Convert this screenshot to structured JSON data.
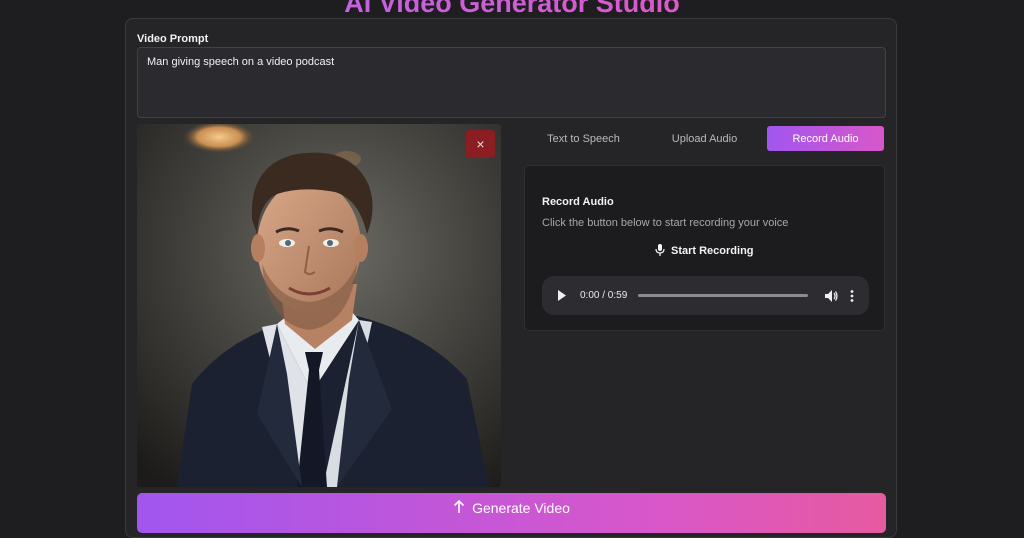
{
  "app": {
    "title": "AI Video Generator Studio"
  },
  "prompt": {
    "label": "Video Prompt",
    "value": "Man giving speech on a video podcast"
  },
  "image": {
    "remove_label": "×"
  },
  "tabs": [
    {
      "label": "Text to Speech",
      "active": false
    },
    {
      "label": "Upload Audio",
      "active": false
    },
    {
      "label": "Record Audio",
      "active": true
    }
  ],
  "record": {
    "title": "Record Audio",
    "description": "Click the button below to start recording your voice",
    "button_label": "Start Recording"
  },
  "audio": {
    "time": "0:00 / 0:59"
  },
  "generate": {
    "label": "Generate Video"
  },
  "colors": {
    "accent_start": "#a156ef",
    "accent_end": "#d957c9",
    "remove_button": "#8a1e22"
  }
}
